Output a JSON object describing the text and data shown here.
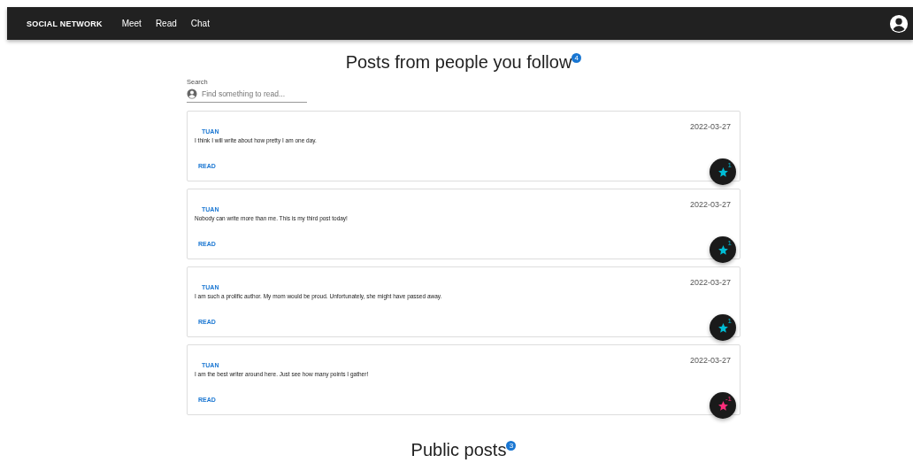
{
  "app_bar": {
    "brand": "SOCIAL NETWORK",
    "links": [
      "Meet",
      "Read",
      "Chat"
    ]
  },
  "following": {
    "title": "Posts from people you follow",
    "count": "4",
    "search": {
      "label": "Search",
      "placeholder": "Find something to read..."
    },
    "posts": [
      {
        "author": "TUAN",
        "date": "2022-03-27",
        "text": "I think I will write about how pretty I am one day.",
        "action": "READ",
        "score": "1",
        "color": "#00bcd4"
      },
      {
        "author": "TUAN",
        "date": "2022-03-27",
        "text": "Nobody can write more than me. This is my third post today!",
        "action": "READ",
        "score": "1",
        "color": "#00bcd4"
      },
      {
        "author": "TUAN",
        "date": "2022-03-27",
        "text": "I am such a prolific author. My mom would be proud. Unfortunately, she might have passed away.",
        "action": "READ",
        "score": "1",
        "color": "#00bcd4"
      },
      {
        "author": "TUAN",
        "date": "2022-03-27",
        "text": "I am the best writer around here. Just see how many points I gather!",
        "action": "READ",
        "score": "-1",
        "color": "#ff2d7a"
      }
    ]
  },
  "public": {
    "title": "Public posts",
    "count": "3"
  }
}
